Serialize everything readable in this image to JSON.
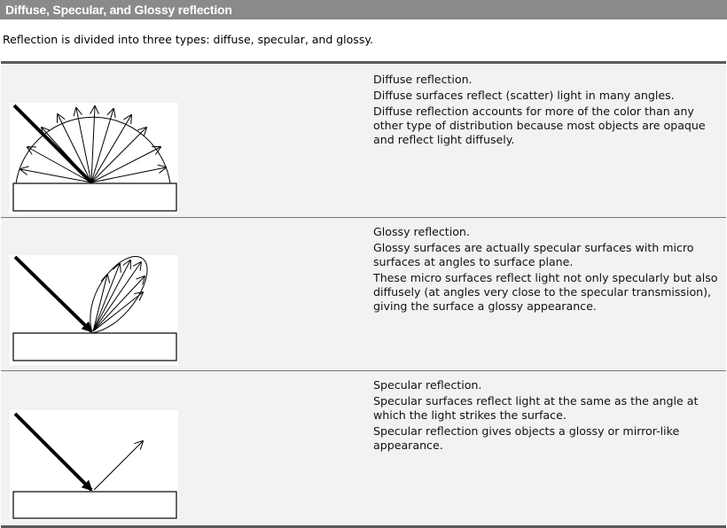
{
  "header": {
    "title": "Diffuse, Specular, and Glossy reflection"
  },
  "intro": "Reflection is divided into three types: diffuse, specular, and glossy.",
  "rows": [
    {
      "title": "Diffuse reflection.",
      "paragraphs": [
        "Diffuse surfaces reflect (scatter) light in many angles.",
        "Diffuse reflection accounts for more of the color than any other type of distribution because most objects are opaque and reflect light diffusely."
      ]
    },
    {
      "title": "Glossy reflection.",
      "paragraphs": [
        "Glossy surfaces are actually specular surfaces with micro surfaces at angles to surface plane.",
        "These micro surfaces reflect light not only specularly but also diffusely (at angles very close to the specular transmission), giving the surface a glossy appearance."
      ]
    },
    {
      "title": "Specular reflection.",
      "paragraphs": [
        "Specular surfaces reflect light at the same as the angle at which the light strikes the surface.",
        "Specular reflection gives objects a glossy or mirror-like appearance."
      ]
    }
  ]
}
